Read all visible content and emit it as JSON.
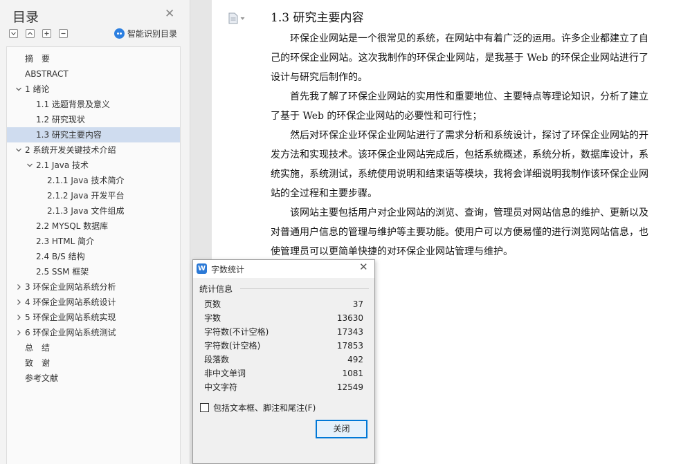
{
  "toc": {
    "title": "目录",
    "smart_recognize_label": "智能识别目录",
    "items": [
      {
        "text": "摘　要",
        "level": 1,
        "expand": "none",
        "selected": false
      },
      {
        "text": "ABSTRACT",
        "level": 1,
        "expand": "none",
        "selected": false
      },
      {
        "text": "1 绪论",
        "level": 1,
        "expand": "open",
        "selected": false
      },
      {
        "text": "1.1 选题背景及意义",
        "level": 2,
        "expand": "none",
        "selected": false
      },
      {
        "text": "1.2 研究现状",
        "level": 2,
        "expand": "none",
        "selected": false
      },
      {
        "text": "1.3 研究主要内容",
        "level": 2,
        "expand": "none",
        "selected": true
      },
      {
        "text": "2 系统开发关键技术介绍",
        "level": 1,
        "expand": "open",
        "selected": false
      },
      {
        "text": "2.1 Java 技术",
        "level": 2,
        "expand": "open",
        "selected": false
      },
      {
        "text": "2.1.1 Java 技术简介",
        "level": 3,
        "expand": "none",
        "selected": false
      },
      {
        "text": "2.1.2 Java 开发平台",
        "level": 3,
        "expand": "none",
        "selected": false
      },
      {
        "text": "2.1.3 Java 文件组成",
        "level": 3,
        "expand": "none",
        "selected": false
      },
      {
        "text": "2.2 MYSQL 数据库",
        "level": 2,
        "expand": "none",
        "selected": false
      },
      {
        "text": "2.3 HTML 简介",
        "level": 2,
        "expand": "none",
        "selected": false
      },
      {
        "text": "2.4 B/S 结构",
        "level": 2,
        "expand": "none",
        "selected": false
      },
      {
        "text": "2.5 SSM 框架",
        "level": 2,
        "expand": "none",
        "selected": false
      },
      {
        "text": "3 环保企业网站系统分析",
        "level": 1,
        "expand": "closed",
        "selected": false
      },
      {
        "text": "4 环保企业网站系统设计",
        "level": 1,
        "expand": "closed",
        "selected": false
      },
      {
        "text": "5 环保企业网站系统实现",
        "level": 1,
        "expand": "closed",
        "selected": false
      },
      {
        "text": "6 环保企业网站系统测试",
        "level": 1,
        "expand": "closed",
        "selected": false
      },
      {
        "text": "总　结",
        "level": 1,
        "expand": "none",
        "selected": false
      },
      {
        "text": "致　谢",
        "level": 1,
        "expand": "none",
        "selected": false
      },
      {
        "text": "参考文献",
        "level": 1,
        "expand": "none",
        "selected": false
      }
    ]
  },
  "document": {
    "heading": "1.3 研究主要内容",
    "paragraphs": [
      "环保企业网站是一个很常见的系统，在网站中有着广泛的运用。许多企业都建立了自己的环保企业网站。这次我制作的环保企业网站，是我基于 Web 的环保企业网站进行了设计与研究后制作的。",
      "首先我了解了环保企业网站的实用性和重要地位、主要特点等理论知识，分析了建立了基于 Web 的环保企业网站的必要性和可行性；",
      "然后对环保企业环保企业网站进行了需求分析和系统设计，探讨了环保企业网站的开发方法和实现技术。该环保企业网站完成后，包括系统概述，系统分析，数据库设计，系统实施，系统测试，系统使用说明和结束语等模块，我将会详细说明我制作该环保企业网站的全过程和主要步骤。",
      "该网站主要包括用户对企业网站的浏览、查询，管理员对网站信息的维护、更新以及对普通用户信息的管理与维护等主要功能。使用户可以方便易懂的进行浏览网站信息，也使管理员可以更简单快捷的对环保企业网站管理与维护。"
    ]
  },
  "word_count_dialog": {
    "title": "字数统计",
    "group_label": "统计信息",
    "rows": [
      {
        "label": "页数",
        "value": "37"
      },
      {
        "label": "字数",
        "value": "13630"
      },
      {
        "label": "字符数(不计空格)",
        "value": "17343"
      },
      {
        "label": "字符数(计空格)",
        "value": "17853"
      },
      {
        "label": "段落数",
        "value": "492"
      },
      {
        "label": "非中文单词",
        "value": "1081"
      },
      {
        "label": "中文字符",
        "value": "12549"
      }
    ],
    "checkbox_label": "包括文本框、脚注和尾注(F)",
    "checkbox_checked": false,
    "close_button_label": "关闭"
  },
  "colors": {
    "selected_item_bg": "#cfdcef",
    "dialog_accent": "#0078d7",
    "app_icon": "#2b79d6"
  }
}
